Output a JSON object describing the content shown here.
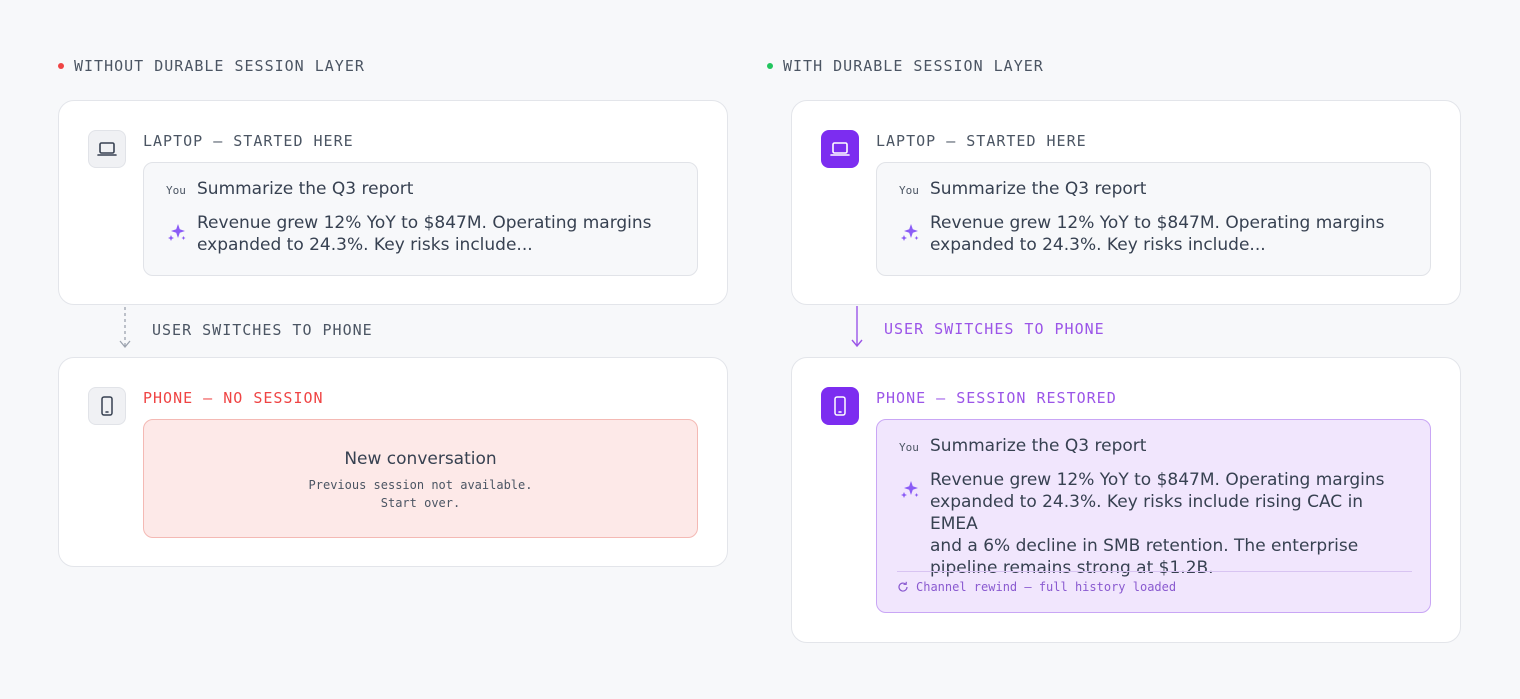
{
  "left": {
    "column_label": "WITHOUT DURABLE SESSION LAYER",
    "column_dot_color": "#ef4444",
    "laptop_card": {
      "title": "LAPTOP — STARTED HERE",
      "icon": "laptop-icon",
      "you_label": "You",
      "user_message": "Summarize the Q3 report",
      "ai_message_line1": "Revenue grew 12% YoY to $847M. Operating margins",
      "ai_message_line2": "expanded to 24.3%. Key risks include..."
    },
    "switch_label": "USER SWITCHES TO PHONE",
    "phone_card": {
      "title": "PHONE — NO SESSION",
      "title_color": "#ef4444",
      "icon": "phone-icon",
      "empty_title": "New conversation",
      "empty_sub_line1": "Previous session not available.",
      "empty_sub_line2": "Start over."
    }
  },
  "right": {
    "column_label": "WITH DURABLE SESSION LAYER",
    "column_dot_color": "#22c55e",
    "laptop_card": {
      "title": "LAPTOP — STARTED HERE",
      "icon": "laptop-icon",
      "you_label": "You",
      "user_message": "Summarize the Q3 report",
      "ai_message_line1": "Revenue grew 12% YoY to $847M. Operating margins",
      "ai_message_line2": "expanded to 24.3%. Key risks include..."
    },
    "switch_label": "USER SWITCHES TO PHONE",
    "switch_color": "#9b55e8",
    "phone_card": {
      "title": "PHONE — SESSION RESTORED",
      "title_color": "#9b55e8",
      "icon": "phone-icon",
      "you_label": "You",
      "user_message": "Summarize the Q3 report",
      "ai_message_lines": [
        "Revenue grew 12% YoY to $847M. Operating margins",
        "expanded to 24.3%. Key risks include rising CAC in EMEA",
        "and a 6% decline in SMB retention. The enterprise",
        "pipeline remains strong at $1.2B."
      ],
      "rewind_icon": "refresh-icon",
      "rewind_text": "Channel rewind — full history loaded"
    }
  }
}
